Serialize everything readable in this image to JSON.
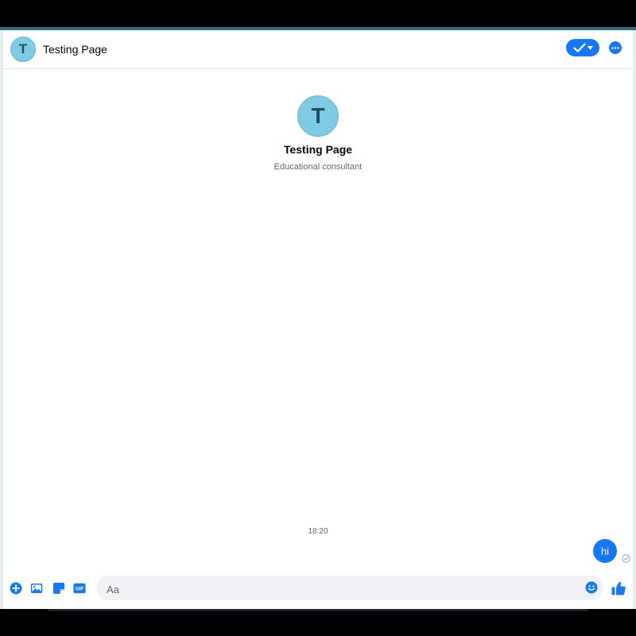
{
  "header": {
    "avatar_initial": "T",
    "title": "Testing Page"
  },
  "profile": {
    "avatar_initial": "T",
    "name": "Testing Page",
    "subtitle": "Educational consultant"
  },
  "conversation": {
    "timestamp": "18:20",
    "messages": [
      {
        "text": "hi",
        "direction": "outgoing",
        "status": "sent"
      }
    ]
  },
  "composer": {
    "placeholder": "Aa",
    "value": "",
    "gif_label": "GIF"
  },
  "colors": {
    "accent": "#1877f2",
    "avatar_bg": "#7fcbe3",
    "avatar_text": "#1e4f63",
    "top_strip": "#2f6f7e"
  },
  "icons": {
    "more_actions": "plus-circle-icon",
    "photo": "image-icon",
    "sticker": "sticker-icon",
    "gif": "gif-icon",
    "emoji": "emoji-icon",
    "like": "thumbs-up-icon",
    "status": "checkmark-icon",
    "options": "ellipsis-icon"
  }
}
